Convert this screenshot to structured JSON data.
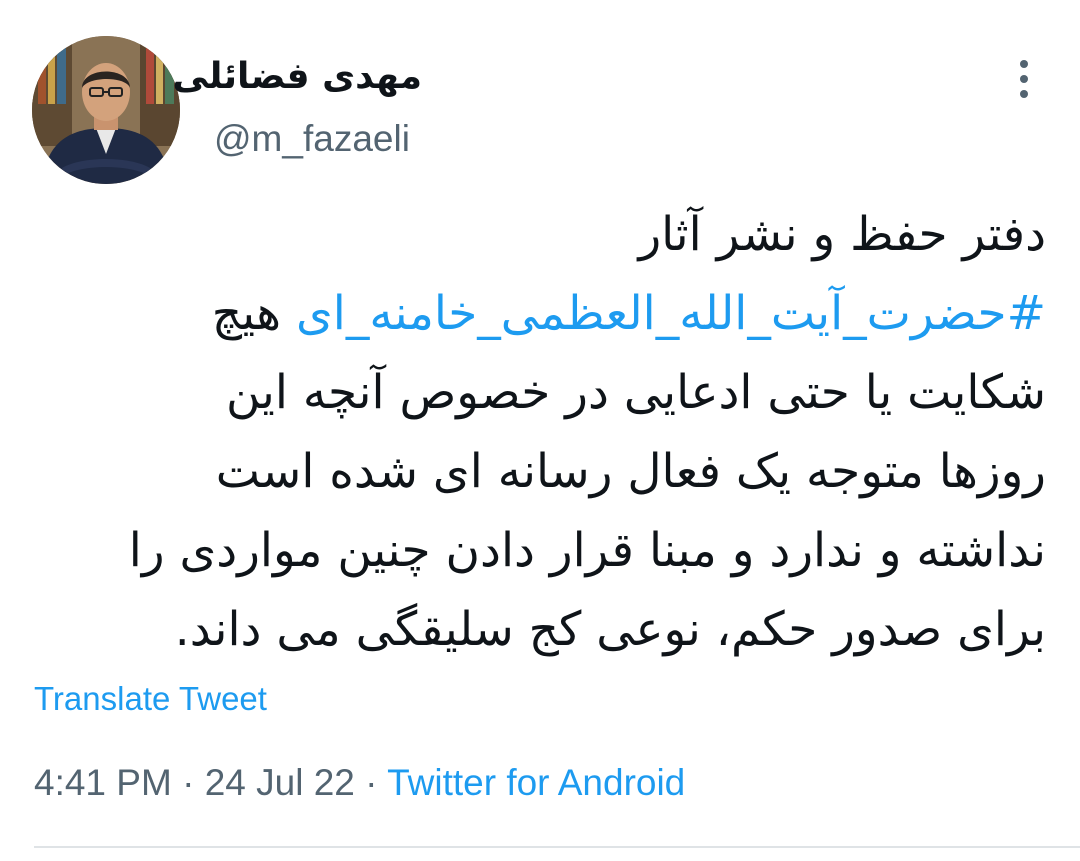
{
  "author": {
    "display_name": "مهدی فضائلی",
    "handle": "@m_fazaeli"
  },
  "icons": {
    "more": "more-vertical-icon",
    "avatar": "profile-photo"
  },
  "tweet": {
    "line1": "دفتر حفظ و نشر آثار",
    "line2_hashtag": "#حضرت_آیت_الله_العظمی_خامنه_ای",
    "line2_rest": " هیچ",
    "line3": "شکایت یا حتی ادعایی در خصوص آنچه این",
    "line4": "روزها متوجه یک فعال رسانه ای شده است",
    "line5": "نداشته و ندارد و مبنا قرار دادن چنین مواردی را",
    "line6": "برای صدور حکم، نوعی کج سلیقگی می داند."
  },
  "translate_label": "Translate Tweet",
  "meta": {
    "time": "4:41 PM",
    "separator": " · ",
    "date": "24 Jul 22",
    "source": "Twitter for Android"
  },
  "colors": {
    "link": "#1d9bf0",
    "secondary": "#536471",
    "text": "#0f1419"
  }
}
